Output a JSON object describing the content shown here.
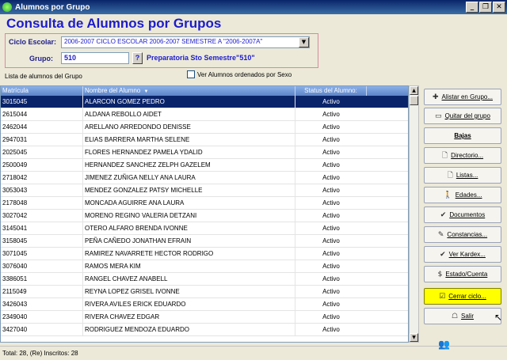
{
  "window": {
    "title": "Alumnos por Grupo",
    "controls": [
      "_",
      "❐",
      "✕"
    ]
  },
  "heading": "Consulta de Alumnos por Grupos",
  "filters": {
    "ciclo_label": "Ciclo Escolar:",
    "ciclo_value": "2006-2007 CICLO ESCOLAR 2006-2007 SEMESTRE A \"2006-2007A\"",
    "grupo_label": "Grupo:",
    "grupo_value": "510",
    "help_label": "?",
    "grupo_desc": "Preparatoria Sto Semestre\"510\""
  },
  "list_caption": "Lista de alumnos del Grupo",
  "sort_checkbox_label": "Ver Alumnos ordenados por Sexo",
  "grid": {
    "headers": [
      "Matrícula",
      "Nombre del Alumno",
      "Status del Alumno:"
    ],
    "sort_icon": "▼",
    "rows": [
      [
        "3015045",
        "ALARCON GOMEZ PEDRO",
        "Activo"
      ],
      [
        "2615044",
        "ALDANA REBOLLO AIDET",
        "Activo"
      ],
      [
        "2462044",
        "ARELLANO ARREDONDO DENISSE",
        "Activo"
      ],
      [
        "2947031",
        "ELIAS BARRERA MARTHA SELENE",
        "Activo"
      ],
      [
        "2025045",
        "FLORES HERNANDEZ PAMELA YDALID",
        "Activo"
      ],
      [
        "2500049",
        "HERNANDEZ SANCHEZ ZELPH GAZELEM",
        "Activo"
      ],
      [
        "2718042",
        "JIMENEZ ZUÑIGA  NELLY ANA LAURA",
        "Activo"
      ],
      [
        "3053043",
        "MENDEZ GONZALEZ PATSY MICHELLE",
        "Activo"
      ],
      [
        "2178048",
        "MONCADA AGUIRRE ANA LAURA",
        "Activo"
      ],
      [
        "3027042",
        "MORENO REGINO VALERIA DETZANI",
        "Activo"
      ],
      [
        "3145041",
        "OTERO ALFARO BRENDA IVONNE",
        "Activo"
      ],
      [
        "3158045",
        "PEÑA CAÑEDO JONATHAN EFRAIN",
        "Activo"
      ],
      [
        "3071045",
        "RAMIREZ NAVARRETE HECTOR RODRIGO",
        "Activo"
      ],
      [
        "3076040",
        "RAMOS MERA KIM",
        "Activo"
      ],
      [
        "3386051",
        "RANGEL CHAVEZ ANABELL",
        "Activo"
      ],
      [
        "2115049",
        "REYNA LOPEZ GRISEL IVONNE",
        "Activo"
      ],
      [
        "3426043",
        "RIVERA AVILES ERICK EDUARDO",
        "Activo"
      ],
      [
        "2349040",
        "RIVERA CHAVEZ EDGAR",
        "Activo"
      ],
      [
        "3427040",
        "RODRIGUEZ MENDOZA EDUARDO",
        "Activo"
      ]
    ]
  },
  "scrollbar": {
    "up": "▲",
    "down": "▼"
  },
  "buttons": [
    {
      "label": "Alistar en Grupo...",
      "icon": "✚",
      "icon_name": "plus-icon"
    },
    {
      "label": "Quitar del grupo",
      "icon": "▭",
      "icon_name": "minus-icon"
    },
    {
      "label": "Bajas",
      "icon": "",
      "icon_name": ""
    },
    {
      "label": "Directorio...",
      "icon": "🗋",
      "icon_name": "document-icon"
    },
    {
      "label": "Listas...",
      "icon": "🗋",
      "icon_name": "list-icon"
    },
    {
      "label": "Edades...",
      "icon": "🚶",
      "icon_name": "person-icon"
    },
    {
      "label": "Documentos",
      "icon": "✔",
      "icon_name": "check-icon"
    },
    {
      "label": "Constancias...",
      "icon": "✎",
      "icon_name": "certificate-icon"
    },
    {
      "label": "Ver Kardex...",
      "icon": "✔",
      "icon_name": "kardex-icon"
    },
    {
      "label": "Estado/Cuenta",
      "icon": "$",
      "icon_name": "dollar-icon"
    },
    {
      "label": "Cerrar ciclo...",
      "icon": "☑",
      "icon_name": "calendar-icon"
    },
    {
      "label": "Salir",
      "icon": "☖",
      "icon_name": "exit-icon"
    }
  ],
  "status": "Total: 28, (Re) Inscritos: 28",
  "accent": "#1c1ccc",
  "selection": "#0a246a",
  "highlight": "#ffff00"
}
